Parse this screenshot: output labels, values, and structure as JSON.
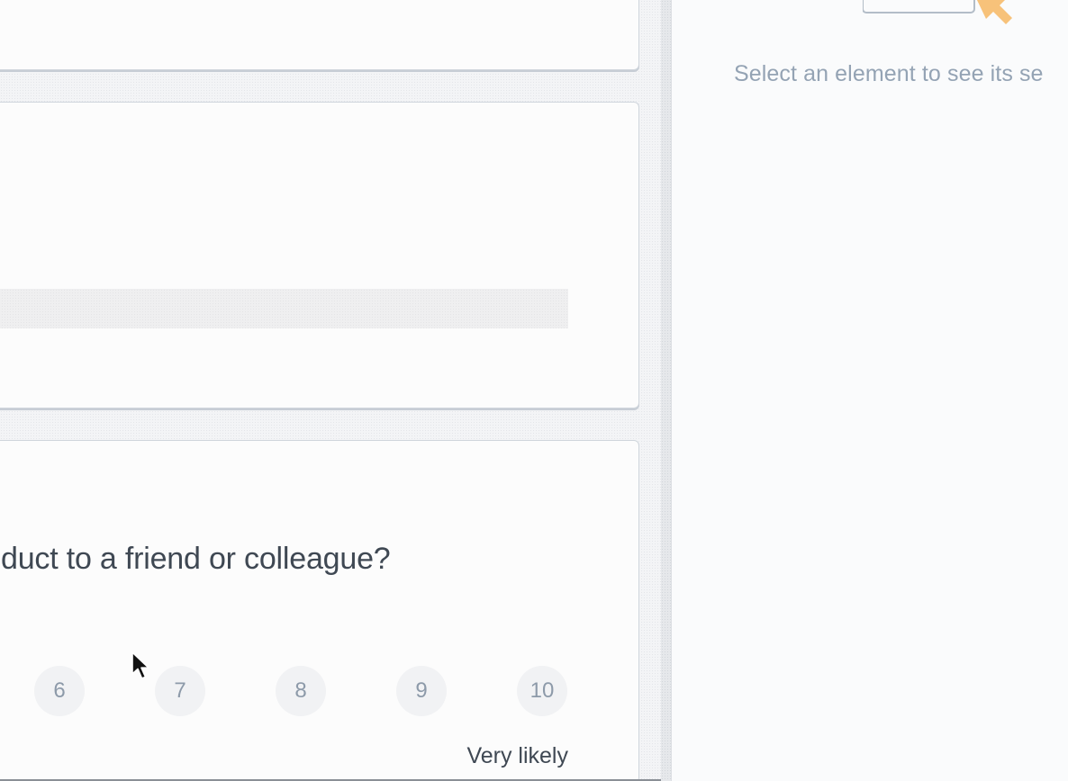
{
  "canvas": {
    "question": {
      "text": "duct to a friend or colleague?"
    },
    "scale": {
      "options": [
        "6",
        "7",
        "8",
        "9",
        "10"
      ],
      "max_label": "Very likely"
    }
  },
  "sidebar": {
    "hint": "Select an element to see its se",
    "illustration_icon": "pointer-select-icon",
    "accent_color": "#f7c27a"
  },
  "colors": {
    "text_primary": "#3f4853",
    "text_muted": "#94a3b4",
    "card_border": "#cfd5dc"
  }
}
